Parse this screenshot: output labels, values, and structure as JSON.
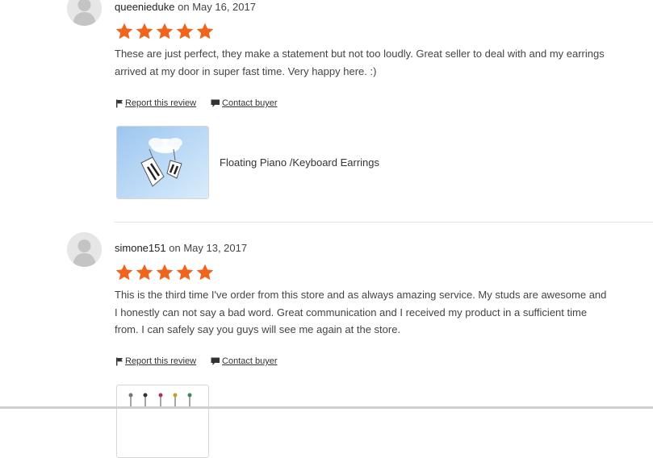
{
  "reviews": [
    {
      "username": "queenieduke",
      "date_prefix": "on",
      "date": "May 16, 2017",
      "rating": 5,
      "text": "These are just perfect, they make a statement but not too loudly. Great seller to deal with and my earrings arrived at my door in super fast time. Very happy here. :)",
      "report_label": "Report this review",
      "contact_label": "Contact buyer",
      "product_name": "Floating Piano /Keyboard Earrings"
    },
    {
      "username": "simone151",
      "date_prefix": "on",
      "date": "May 13, 2017",
      "rating": 5,
      "text": "This is the third time I've order from this store and as always amazing service. My studs are awesome and I honestly can not say a bad word. Great communication and I received my product in a sufficient time from. I can safely say you guys will see me again at the store.",
      "report_label": "Report this review",
      "contact_label": "Contact buyer"
    }
  ],
  "colors": {
    "star": "#f1641e",
    "divider": "#e3e3e3",
    "text": "#444444"
  },
  "icons": {
    "avatar": "default-user-avatar-icon",
    "star": "star-icon",
    "report": "flag-icon",
    "contact": "speech-bubble-icon"
  }
}
